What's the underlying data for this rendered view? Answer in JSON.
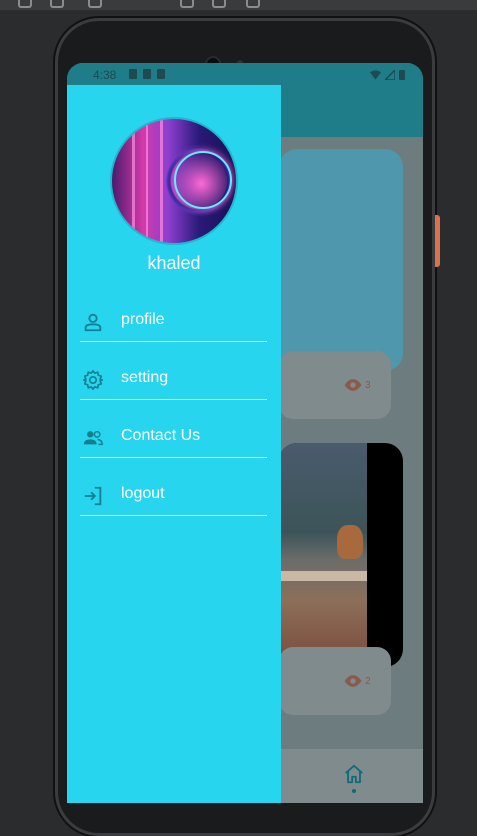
{
  "status_bar": {
    "time": "4:38"
  },
  "drawer": {
    "username": "khaled",
    "menu": [
      {
        "label": "profile",
        "icon": "person-icon"
      },
      {
        "label": "setting",
        "icon": "gear-icon"
      },
      {
        "label": "Contact Us",
        "icon": "people-icon"
      },
      {
        "label": "logout",
        "icon": "logout-icon"
      }
    ]
  },
  "background_feed": {
    "cards": [
      {
        "views": "3"
      },
      {
        "views": "2"
      }
    ]
  },
  "colors": {
    "drawer": "#27d5ee",
    "app_bar": "#1e7d88",
    "accent": "#0f6b78"
  }
}
